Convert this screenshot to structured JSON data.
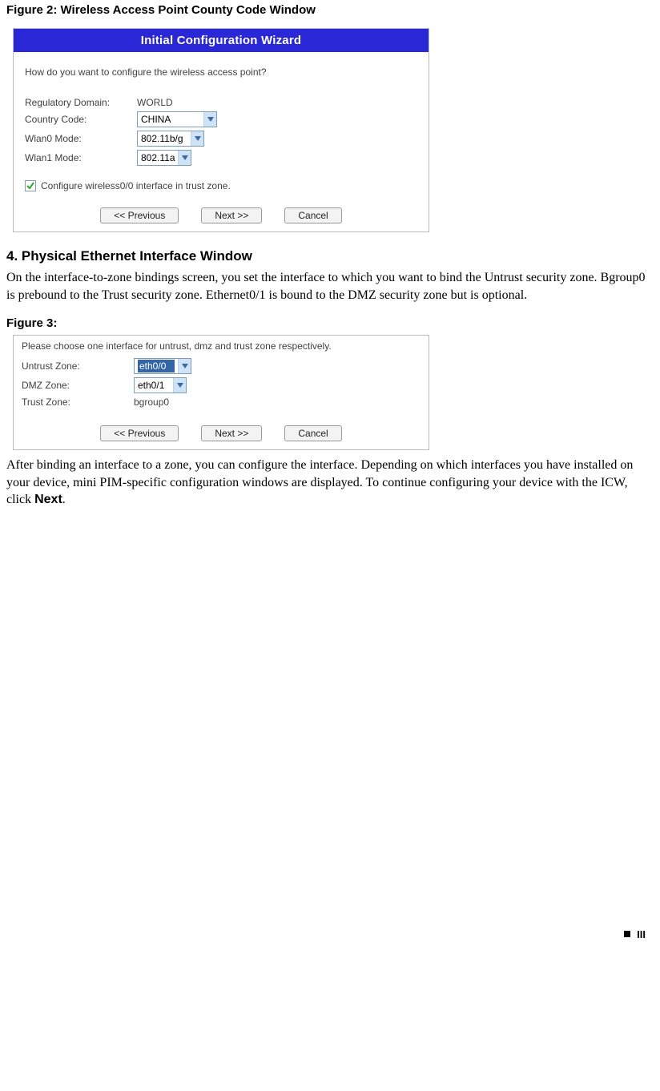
{
  "figure2": {
    "caption": "Figure 2:  Wireless Access Point County Code Window",
    "titlebar": "Initial Configuration Wizard",
    "prompt": "How do you want to configure the wireless access point?",
    "rows": {
      "reg_domain_label": "Regulatory Domain:",
      "reg_domain_value": "WORLD",
      "country_code_label": "Country Code:",
      "country_code_value": "CHINA",
      "wlan0_label": "Wlan0 Mode:",
      "wlan0_value": "802.11b/g",
      "wlan1_label": "Wlan1 Mode:",
      "wlan1_value": "802.11a"
    },
    "checkbox_label": "Configure wireless0/0 interface in trust zone.",
    "buttons": {
      "previous": "<< Previous",
      "next": "Next >>",
      "cancel": "Cancel"
    }
  },
  "section4": {
    "title": "4. Physical Ethernet Interface Window",
    "body": "On the interface-to-zone bindings screen, you set the interface to which you want to bind the Untrust security zone. Bgroup0 is prebound to the Trust security zone. Ethernet0/1 is bound to the DMZ security zone but is optional."
  },
  "figure3": {
    "caption": "Figure 3:",
    "prompt": "Please choose one interface for untrust, dmz and trust zone respectively.",
    "rows": {
      "untrust_label": "Untrust Zone:",
      "untrust_value": "eth0/0",
      "dmz_label": "DMZ Zone:",
      "dmz_value": "eth0/1",
      "trust_label": "Trust Zone:",
      "trust_value": "bgroup0"
    },
    "buttons": {
      "previous": "<< Previous",
      "next": "Next >>",
      "cancel": "Cancel"
    }
  },
  "after_figure3": {
    "body_pre": "After binding an interface to a zone, you can configure the interface. Depending on which interfaces you have installed on your device, mini PIM-specific configuration windows are displayed. To continue configuring your device with the ICW, click ",
    "next_bold": "Next",
    "period": "."
  },
  "footer": {
    "page_label": "III"
  }
}
